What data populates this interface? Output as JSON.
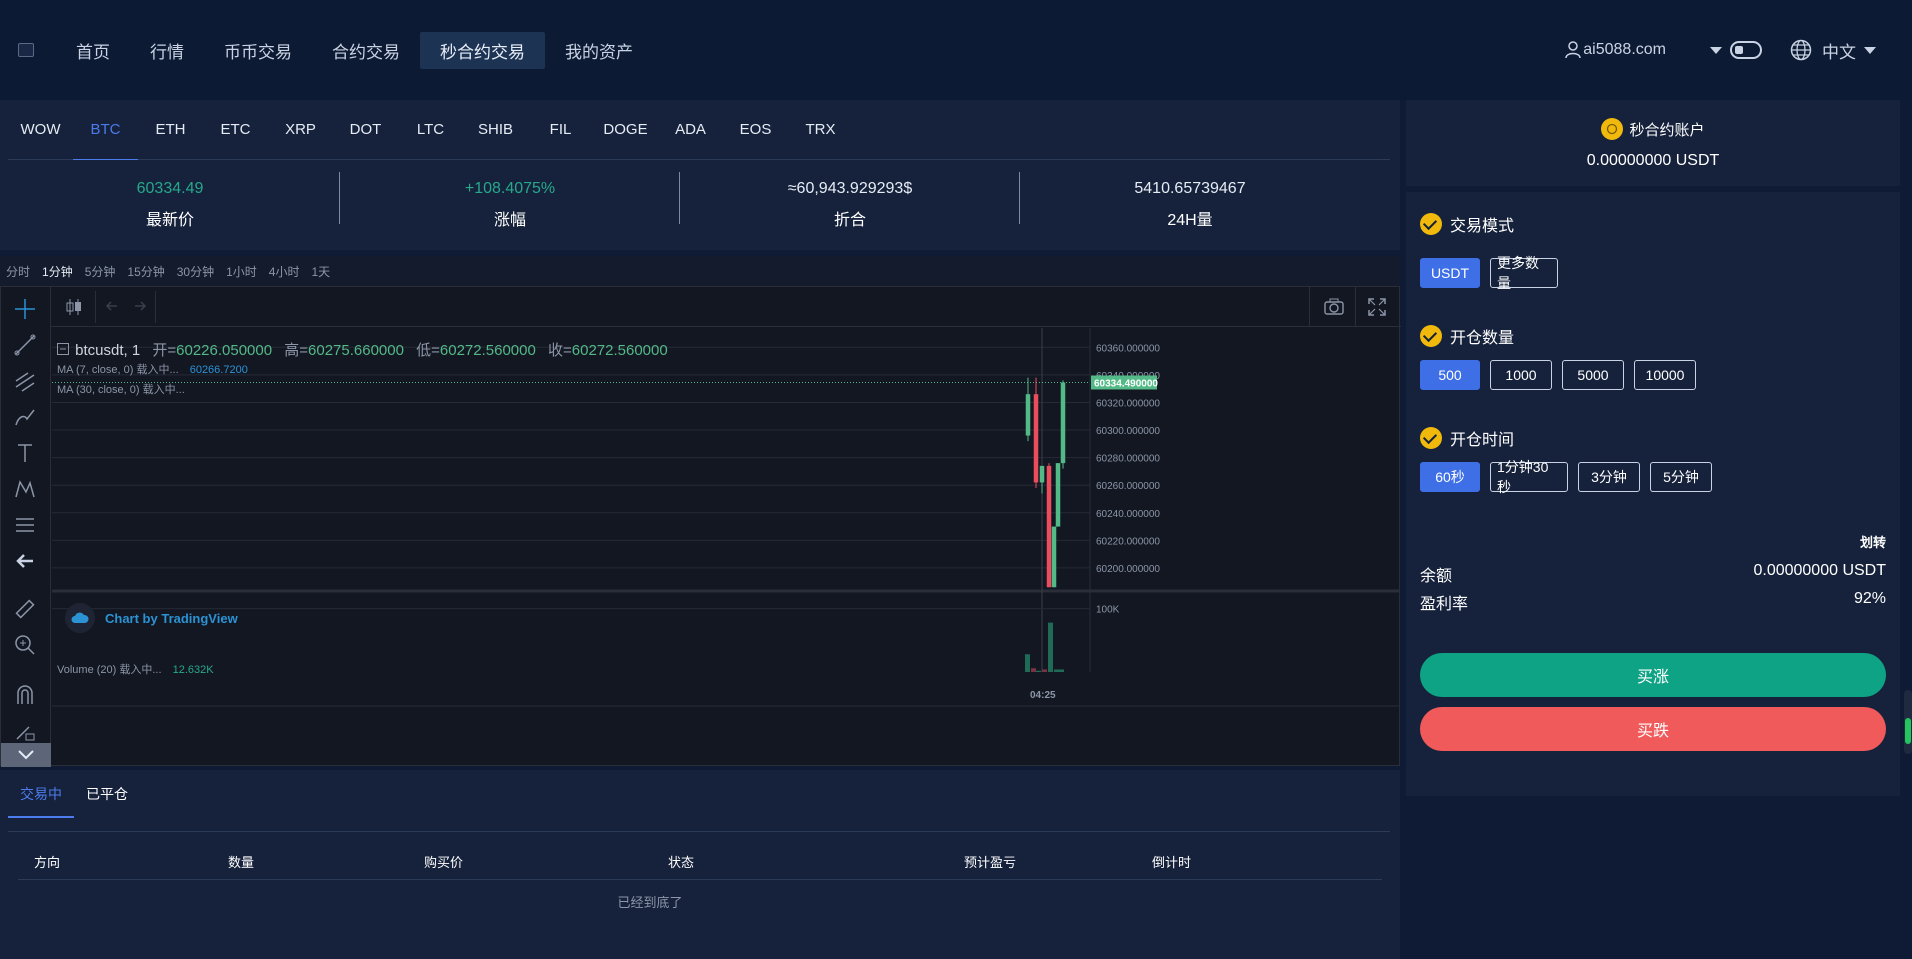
{
  "nav": {
    "items": [
      {
        "label": "首页",
        "active": false
      },
      {
        "label": "行情",
        "active": false
      },
      {
        "label": "币币交易",
        "active": false
      },
      {
        "label": "合约交易",
        "active": false
      },
      {
        "label": "秒合约交易",
        "active": true
      },
      {
        "label": "我的资产",
        "active": false
      }
    ],
    "user": "ai5088.com",
    "language": "中文"
  },
  "coin_tabs": {
    "items": [
      "WOW",
      "BTC",
      "ETH",
      "ETC",
      "XRP",
      "DOT",
      "LTC",
      "SHIB",
      "FIL",
      "DOGE",
      "ADA",
      "EOS",
      "TRX"
    ],
    "active": "BTC"
  },
  "stats": [
    {
      "value": "60334.49",
      "label": "最新价",
      "color": "#26a88c"
    },
    {
      "value": "+108.4075%",
      "label": "涨幅",
      "color": "#26a88c"
    },
    {
      "value": "≈60,943.929293$",
      "label": "折合",
      "color": "#ffffff"
    },
    {
      "value": "5410.65739467",
      "label": "24H量",
      "color": "#ffffff"
    }
  ],
  "intervals": {
    "items": [
      "分时",
      "1分钟",
      "5分钟",
      "15分钟",
      "30分钟",
      "1小时",
      "4小时",
      "1天"
    ],
    "active": "1分钟"
  },
  "chart": {
    "symbol": "btcusdt, 1",
    "open_label": "开=",
    "open": "60226.050000",
    "high_label": "高=",
    "high": "60275.660000",
    "low_label": "低=",
    "low": "60272.560000",
    "close_label": "收=",
    "close": "60272.560000",
    "ma7_label": "MA (7, close, 0) 载入中...",
    "ma7_value": "60266.7200",
    "ma30_label": "MA (30, close, 0) 载入中...",
    "volume_label": "Volume (20) 载入中...",
    "volume_value": "12.632K",
    "volume_tick": "100K",
    "current_price": "60334.490000",
    "price_ticks": [
      "60360.000000",
      "60340.000000",
      "60320.000000",
      "60300.000000",
      "60280.000000",
      "60260.000000",
      "60240.000000",
      "60220.000000",
      "60200.000000"
    ],
    "time_tick": "04:25",
    "watermark": "Chart by TradingView",
    "colors": {
      "up": "#53b987",
      "down": "#eb4d5c",
      "price_tag": "#53b987"
    }
  },
  "chart_data": {
    "type": "candlestick",
    "y_ticks": [
      60360,
      60340,
      60320,
      60300,
      60280,
      60260,
      60240,
      60220,
      60200
    ],
    "ylim": [
      60184,
      60374
    ],
    "x_label": "04:25",
    "current_price": 60334.49,
    "candles": [
      {
        "o": 60296,
        "h": 60338,
        "l": 60292,
        "c": 60326
      },
      {
        "o": 60326,
        "h": 60338,
        "l": 60258,
        "c": 60262
      },
      {
        "o": 60262,
        "h": 60274,
        "l": 60254,
        "c": 60274
      },
      {
        "o": 60274,
        "h": 60276,
        "l": 60186,
        "c": 60186
      },
      {
        "o": 60186,
        "h": 60230,
        "l": 60186,
        "c": 60230
      },
      {
        "o": 60230,
        "h": 60276,
        "l": 60230,
        "c": 60276
      },
      {
        "o": 60276,
        "h": 60336,
        "l": 60272,
        "c": 60334.49
      }
    ],
    "volume": [
      {
        "v": 28,
        "dir": "up"
      },
      {
        "v": 6,
        "dir": "down"
      },
      {
        "v": 2,
        "dir": "up"
      },
      {
        "v": 4,
        "dir": "down"
      },
      {
        "v": 78,
        "dir": "up"
      },
      {
        "v": 4,
        "dir": "up"
      },
      {
        "v": 4,
        "dir": "up"
      }
    ],
    "volume_ylim": [
      0,
      120
    ]
  },
  "account": {
    "title": "秒合约账户",
    "balance": "0.00000000 USDT"
  },
  "trade": {
    "mode_title": "交易模式",
    "mode_options": [
      {
        "label": "USDT",
        "active": true
      },
      {
        "label": "更多数量",
        "active": false
      }
    ],
    "qty_title": "开仓数量",
    "qty_options": [
      {
        "label": "500",
        "active": true
      },
      {
        "label": "1000",
        "active": false
      },
      {
        "label": "5000",
        "active": false
      },
      {
        "label": "10000",
        "active": false
      }
    ],
    "time_title": "开仓时间",
    "time_options": [
      {
        "label": "60秒",
        "active": true
      },
      {
        "label": "1分钟30秒",
        "active": false
      },
      {
        "label": "3分钟",
        "active": false
      },
      {
        "label": "5分钟",
        "active": false
      }
    ],
    "transfer": "划转",
    "balance_label": "余额",
    "balance_value": "0.00000000 USDT",
    "profit_label": "盈利率",
    "profit_value": "92%",
    "buy_up": "买涨",
    "buy_down": "买跌"
  },
  "orders": {
    "tabs": [
      {
        "label": "交易中",
        "active": true
      },
      {
        "label": "已平仓",
        "active": false
      }
    ],
    "columns": [
      "方向",
      "数量",
      "购买价",
      "状态",
      "预计盈亏",
      "倒计时"
    ],
    "empty": "已经到底了"
  }
}
